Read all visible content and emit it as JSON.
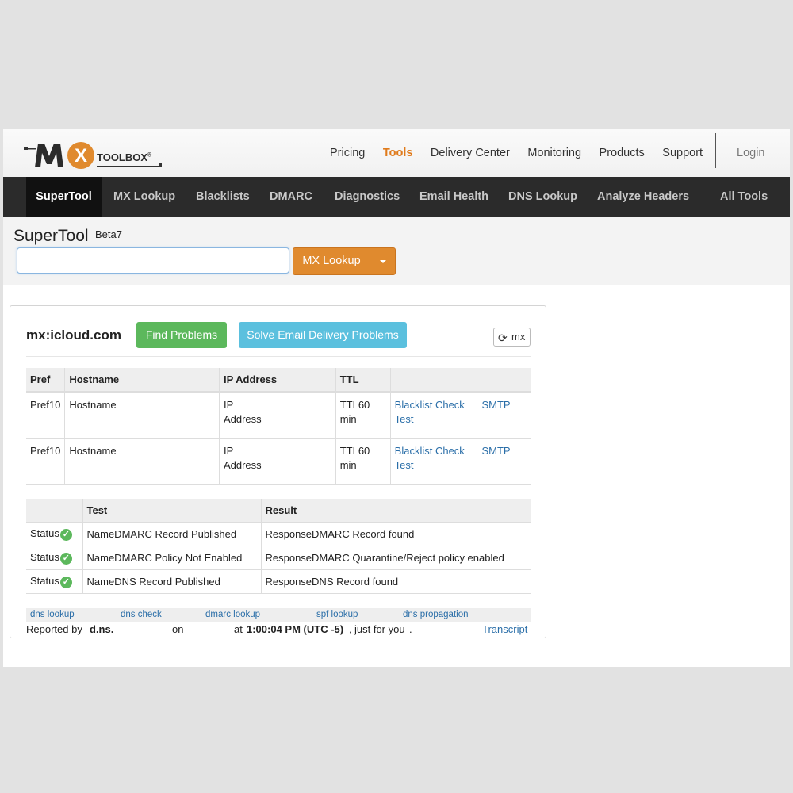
{
  "header": {
    "logo_text": "MX TOOLBOX",
    "nav": [
      "Pricing",
      "Tools",
      "Delivery Center",
      "Monitoring",
      "Products",
      "Support"
    ],
    "active_nav": "Tools",
    "login": "Login"
  },
  "mainnav": {
    "items": [
      "SuperTool",
      "MX Lookup",
      "Blacklists",
      "DMARC",
      "Diagnostics",
      "Email Health",
      "DNS Lookup",
      "Analyze Headers",
      "All Tools"
    ],
    "active": "SuperTool"
  },
  "supertool": {
    "title": "SuperTool",
    "badge": "Beta7",
    "input_value": "",
    "button_label": "MX Lookup"
  },
  "result": {
    "domain": "mx:icloud.com",
    "find_problems": "Find Problems",
    "solve_problems": "Solve Email Delivery Problems",
    "refresh_label": "mx",
    "mx_headers": [
      "Pref",
      "Hostname",
      "IP Address",
      "TTL",
      ""
    ],
    "mx_rows": [
      {
        "pref": "Pref10",
        "hostname": "Hostname",
        "ip": "IP Address",
        "ttl": "TTL60 min",
        "link1": "Blacklist Check",
        "link2": "SMTP Test"
      },
      {
        "pref": "Pref10",
        "hostname": "Hostname",
        "ip": "IP Address",
        "ttl": "TTL60 min",
        "link1": "Blacklist Check",
        "link2": "SMTP Test"
      }
    ],
    "test_headers": [
      "",
      "Test",
      "Result"
    ],
    "test_rows": [
      {
        "status": "Status",
        "test": "NameDMARC Record Published",
        "result": "ResponseDMARC Record found"
      },
      {
        "status": "Status",
        "test": "NameDMARC Policy Not Enabled",
        "result": "ResponseDMARC Quarantine/Reject policy enabled"
      },
      {
        "status": "Status",
        "test": "NameDNS Record Published",
        "result": "ResponseDNS Record found"
      }
    ],
    "bottom_links": [
      "dns lookup",
      "dns check",
      "dmarc lookup",
      "spf lookup",
      "dns propagation"
    ],
    "footer": {
      "reported_by": "Reported by",
      "reporter": "d.ns.",
      "on": "on",
      "at": "at",
      "time": "1:00:04 PM (UTC -5)",
      "comma": ",",
      "just_for_you": "just for you",
      "period": ".",
      "transcript": "Transcript"
    }
  },
  "colors": {
    "accent_orange": "#e08a2e",
    "dark_nav": "#2b2b2b",
    "green": "#5cb85c",
    "blue": "#5bc0de",
    "link": "#2a6ea8"
  }
}
